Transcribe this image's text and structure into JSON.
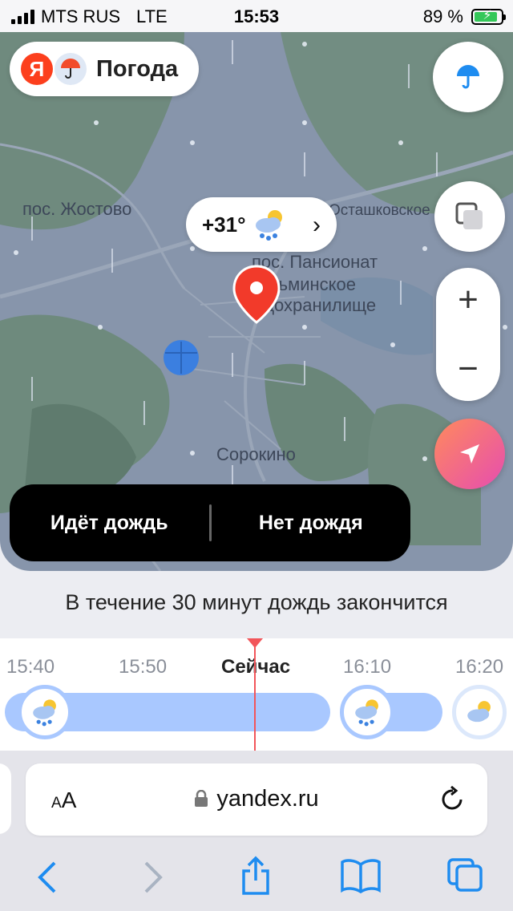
{
  "status_bar": {
    "carrier": "MTS RUS",
    "network": "LTE",
    "time": "15:53",
    "battery_percent": "89 %",
    "battery_level": 0.89
  },
  "app": {
    "logo_letter": "Я",
    "brand_name": "Погода"
  },
  "map": {
    "places": [
      "пос. Жостово",
      "Осташковское",
      "пос. Пансионат",
      "Клязьминское",
      "водохранилище",
      "Сорокино"
    ],
    "weather_badge": {
      "temperature": "+31°",
      "chevron": "›"
    },
    "zoom": {
      "in": "+",
      "out": "−"
    },
    "rain_toggle": {
      "raining_label": "Идёт дождь",
      "no_rain_label": "Нет дождя"
    }
  },
  "forecast": {
    "message": "В течение 30 минут дождь закончится"
  },
  "timeline": {
    "labels": [
      "15:40",
      "15:50",
      "Сейчас",
      "16:10",
      "16:20"
    ]
  },
  "browser": {
    "aa_small": "A",
    "aa_large": "A",
    "url": "yandex.ru"
  },
  "colors": {
    "accent": "#1e8cf0",
    "map": "#8795ab",
    "rain_bar": "#a9c8ff",
    "now_cursor": "#f2555a",
    "pin": "#f23a2a"
  }
}
